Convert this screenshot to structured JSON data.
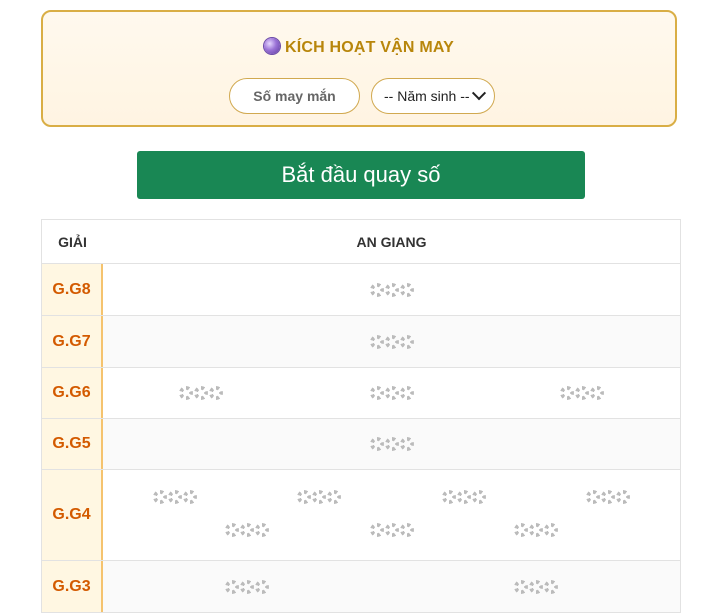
{
  "lucky_box": {
    "title": "KÍCH HOẠT VẬN MAY",
    "title_icon": "crystal-ball-icon",
    "lucky_number_placeholder": "Số may mắn",
    "birth_year_selected": "-- Năm sinh --",
    "border_color": "#d9ae45"
  },
  "spin_button": {
    "label": "Bắt đầu quay số",
    "color": "#198754"
  },
  "table": {
    "header": {
      "prize": "GIẢI",
      "province": "AN GIANG"
    },
    "accent_color": "#d35a00",
    "rows": [
      {
        "prize": "G.G8",
        "loading_count": 1
      },
      {
        "prize": "G.G7",
        "loading_count": 1
      },
      {
        "prize": "G.G6",
        "loading_count": 3
      },
      {
        "prize": "G.G5",
        "loading_count": 1
      },
      {
        "prize": "G.G4",
        "loading_count": 7
      },
      {
        "prize": "G.G3",
        "loading_count": 2
      }
    ]
  }
}
